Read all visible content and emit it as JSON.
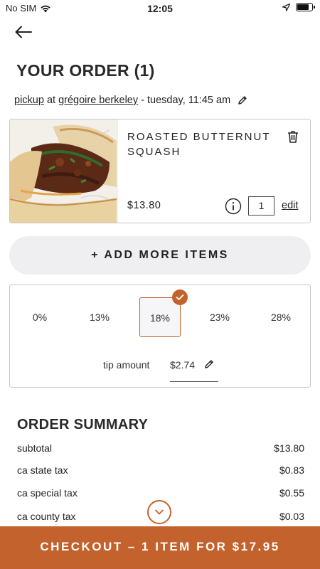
{
  "status_bar": {
    "carrier": "No SIM",
    "time": "12:05",
    "battery_level": 0.85
  },
  "header": {
    "back_icon": "arrow-left-icon",
    "title": "YOUR ORDER (1)"
  },
  "pickup": {
    "mode": "pickup",
    "at": "at",
    "location": "grégoire berkeley",
    "time": "- tuesday, 11:45 am",
    "edit_icon": "pencil-icon"
  },
  "cart": {
    "items": [
      {
        "name": "ROASTED BUTTERNUT SQUASH",
        "price": "$13.80",
        "quantity": "1",
        "edit_label": "edit",
        "image": "sandwich-photo"
      }
    ]
  },
  "add_more": {
    "label": "+ ADD MORE ITEMS"
  },
  "tip": {
    "options": [
      "0%",
      "13%",
      "18%",
      "23%",
      "28%"
    ],
    "selected": "18%",
    "amount_label": "tip amount",
    "amount": "$2.74"
  },
  "summary": {
    "title": "ORDER SUMMARY",
    "rows": [
      {
        "label": "subtotal",
        "value": "$13.80"
      },
      {
        "label": "ca state tax",
        "value": "$0.83"
      },
      {
        "label": "ca special tax",
        "value": "$0.55"
      },
      {
        "label": "ca county tax",
        "value": "$0.03"
      }
    ]
  },
  "checkout": {
    "label": "CHECKOUT – 1 ITEM FOR $17.95"
  },
  "colors": {
    "accent": "#c4622d",
    "button_bg": "#efeff1"
  }
}
